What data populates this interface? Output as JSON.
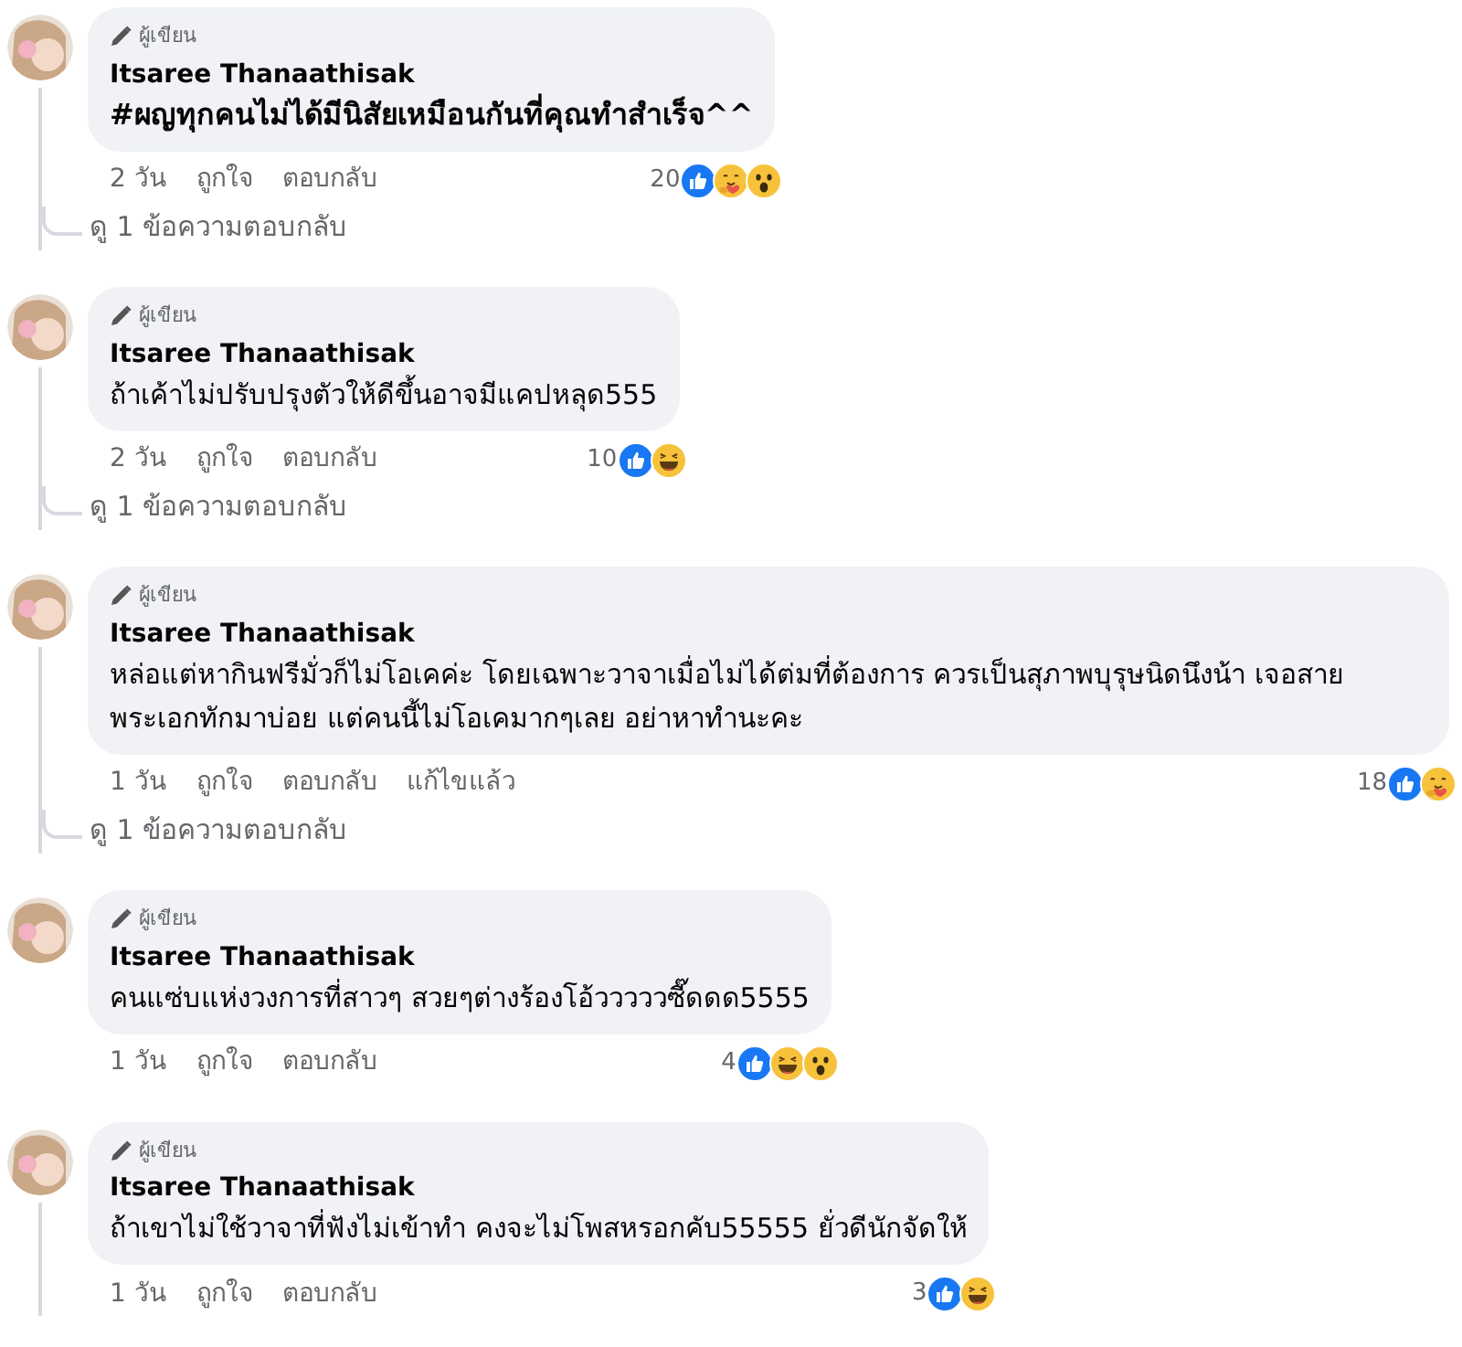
{
  "comments": [
    {
      "badge": "ผู้เขียน",
      "author": "Itsaree Thanaathisak",
      "text": "#ผญทุกคนไม่ได้มีนิสัยเหมือนกันที่คุณทำสำเร็จ^^",
      "bold": true,
      "time": "2 วัน",
      "like": "ถูกใจ",
      "reply": "ตอบกลับ",
      "reaction_count": "20",
      "reactions": [
        {
          "kind": "like"
        },
        {
          "kind": "care"
        },
        {
          "kind": "wow"
        }
      ],
      "has_replies": true,
      "reply_link": "ดู 1 ข้อความตอบกลับ"
    },
    {
      "badge": "ผู้เขียน",
      "author": "Itsaree Thanaathisak",
      "text": "ถ้าเค้าไม่ปรับปรุงตัวให้ดีขึ้นอาจมีแคปหลุด555",
      "bold": false,
      "time": "2 วัน",
      "like": "ถูกใจ",
      "reply": "ตอบกลับ",
      "reaction_count": "10",
      "reactions": [
        {
          "kind": "like"
        },
        {
          "kind": "haha"
        }
      ],
      "has_replies": true,
      "reply_link": "ดู 1 ข้อความตอบกลับ"
    },
    {
      "badge": "ผู้เขียน",
      "author": "Itsaree Thanaathisak",
      "text": "หล่อแต่หากินฟรีมั่วก็ไม่โอเคค่ะ โดยเฉพาะวาจาเมื่อไม่ได้ต่มที่ต้องการ ควรเป็นสุภาพบุรุษนิดนึงน้า เจอสายพระเอกทักมาบ่อย แต่คนนี้ไม่โอเคมากๆเลย อย่าหาทำนะคะ",
      "bold": false,
      "time": "1 วัน",
      "like": "ถูกใจ",
      "reply": "ตอบกลับ",
      "edited": "แก้ไขแล้ว",
      "reaction_count": "18",
      "reactions": [
        {
          "kind": "like"
        },
        {
          "kind": "care"
        }
      ],
      "has_replies": true,
      "reply_link": "ดู 1 ข้อความตอบกลับ"
    },
    {
      "badge": "ผู้เขียน",
      "author": "Itsaree Thanaathisak",
      "text": "คนแซ่บแห่งวงการที่สาวๆ สวยๆต่างร้องโอ้วววววซี๊ดดด5555",
      "bold": false,
      "time": "1 วัน",
      "like": "ถูกใจ",
      "reply": "ตอบกลับ",
      "reaction_count": "4",
      "reactions": [
        {
          "kind": "like"
        },
        {
          "kind": "haha"
        },
        {
          "kind": "wow"
        }
      ],
      "has_replies": false
    },
    {
      "badge": "ผู้เขียน",
      "author": "Itsaree Thanaathisak",
      "text": "ถ้าเขาไม่ใช้วาจาที่ฟังไม่เข้าทำ คงจะไม่โพสหรอกคับ55555 ยั่วดีนักจัดให้",
      "bold": false,
      "time": "1 วัน",
      "like": "ถูกใจ",
      "reply": "ตอบกลับ",
      "reaction_count": "3",
      "reactions": [
        {
          "kind": "like"
        },
        {
          "kind": "haha"
        }
      ],
      "has_replies": true
    }
  ]
}
